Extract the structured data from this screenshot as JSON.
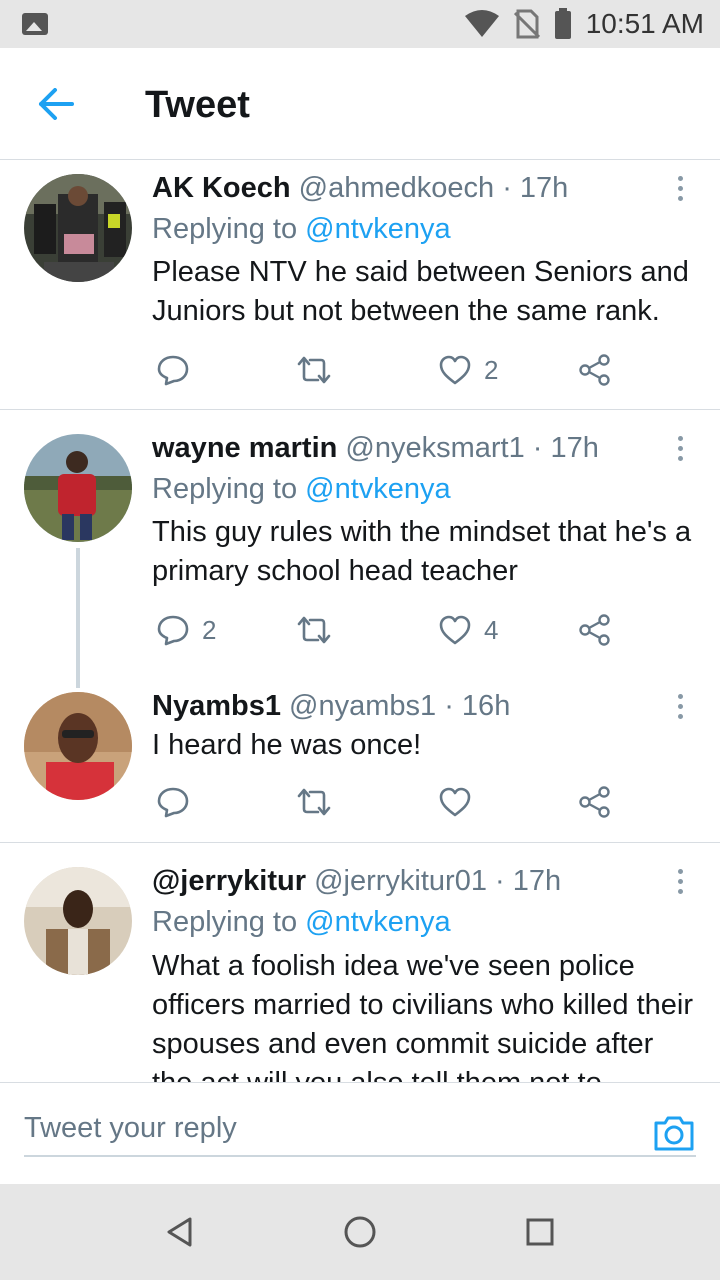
{
  "status_bar": {
    "time": "10:51 AM",
    "icons": [
      "gallery-icon",
      "wifi-icon",
      "no-sim-icon",
      "battery-icon"
    ]
  },
  "header": {
    "title": "Tweet",
    "back_icon": "back-arrow-icon"
  },
  "colors": {
    "accent": "#1da1f2",
    "text": "#14171a",
    "meta": "#657786",
    "divider": "#d8dde2"
  },
  "tweets": [
    {
      "name": "AK Koech",
      "handle": "@ahmedkoech",
      "time": "· 17h",
      "replying_label": "Replying to",
      "replying_handle": "@ntvkenya",
      "text": "Please NTV he said between Seniors and Juniors but not between the same rank.",
      "replies": "",
      "retweets": "",
      "likes": "2"
    },
    {
      "name": "wayne martin",
      "handle": "@nyeksmart1",
      "time": "· 17h",
      "replying_label": "Replying to",
      "replying_handle": "@ntvkenya",
      "text": "This guy rules with the mindset that he's a primary school head teacher",
      "replies": "2",
      "retweets": "",
      "likes": "4"
    },
    {
      "name": "Nyambs1",
      "handle": "@nyambs1",
      "time": "· 16h",
      "text": "I heard he was once!",
      "replies": "",
      "retweets": "",
      "likes": ""
    },
    {
      "name": "@jerrykitur",
      "handle": "@jerrykitur01",
      "time": "· 17h",
      "replying_label": "Replying to",
      "replying_handle": "@ntvkenya",
      "text": "What a foolish idea we've seen police officers married to civilians who killed their spouses and even commit suicide after the act will you also tell them not to"
    }
  ],
  "reply_bar": {
    "placeholder": "Tweet your reply",
    "camera_icon": "camera-icon"
  },
  "nav_bar": {
    "icons": [
      "back-triangle-icon",
      "home-circle-icon",
      "recents-square-icon"
    ]
  }
}
